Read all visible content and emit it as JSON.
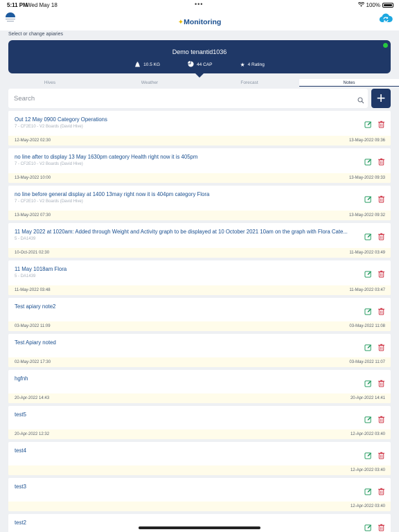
{
  "status": {
    "time": "5:11 PM",
    "date": "Wed May 18",
    "battery": "100%"
  },
  "header": {
    "title": "Monitoring"
  },
  "section_label": "Select or change apiaries",
  "apiary": {
    "name": "Demo tenantid1036",
    "weight": "10.5 KG",
    "capacity": "44 CAP",
    "rating": "4 Rating"
  },
  "tabs": [
    {
      "label": "Hives",
      "active": false
    },
    {
      "label": "Weather",
      "active": false
    },
    {
      "label": "Forecast",
      "active": false
    },
    {
      "label": "Notes",
      "active": true
    }
  ],
  "search": {
    "placeholder": "Search"
  },
  "notes": [
    {
      "title": "Out 12 May 0900 Category Operations",
      "sub": "7 - CF2E10 - V2 Boards (David Hive)",
      "left_date": "12-May-2022 02:30",
      "right_date": "13-May-2022 09:36"
    },
    {
      "title": "no line after to display 13 May 1630pm category Health right now it is 405pm",
      "sub": "7 - CF2E10 - V2 Boards (David Hive)",
      "left_date": "13-May-2022 10:00",
      "right_date": "13-May-2022 09:33"
    },
    {
      "title": "no line before general display at 1400 13may right now it is 404pm category Flora",
      "sub": "7 - CF2E10 - V2 Boards (David Hive)",
      "left_date": "13-May-2022 07:30",
      "right_date": "13-May-2022 09:32"
    },
    {
      "title": "11 May 2022 at 1020am:  Added through Weight and Activity graph to be displayed at 10 October 2021 10am on the graph with Flora Cate...",
      "sub": "5 - DA1439",
      "left_date": "10-Oct-2021 02:30",
      "right_date": "11-May-2022 03:49"
    },
    {
      "title": "11 May 1018am Flora",
      "sub": "5 - DA1439",
      "left_date": "11-May-2022 03:48",
      "right_date": "11-May-2022 03:47"
    },
    {
      "title": "Test apiary note2",
      "sub": "",
      "left_date": "03-May-2022 11:09",
      "right_date": "03-May-2022 11:08"
    },
    {
      "title": "Test Apiary noted",
      "sub": "",
      "left_date": "02-May-2022 17:30",
      "right_date": "03-May-2022 11:07"
    },
    {
      "title": "hgfnh",
      "sub": "",
      "left_date": "20-Apr-2022 14:43",
      "right_date": "20-Apr-2022 14:41"
    },
    {
      "title": "test5",
      "sub": "",
      "left_date": "20-Apr-2022 12:32",
      "right_date": "12-Apr-2022 03:40"
    },
    {
      "title": "test4",
      "sub": "",
      "left_date": "",
      "right_date": "12-Apr-2022 03:40"
    },
    {
      "title": "test3",
      "sub": "",
      "left_date": "",
      "right_date": "12-Apr-2022 03:40"
    },
    {
      "title": "test2",
      "sub": "",
      "left_date": "",
      "right_date": "12-Apr-2022 03:40"
    }
  ],
  "colors": {
    "primary": "#1f3867",
    "edit": "#2a9d64",
    "delete": "#d03a4b",
    "online": "#27c93f",
    "footer_bg": "#fffcea"
  },
  "icons": {
    "edit": "edit-icon",
    "delete": "trash-icon",
    "add": "plus-icon",
    "cloud": "cloud-sync-icon",
    "search": "search-icon"
  }
}
